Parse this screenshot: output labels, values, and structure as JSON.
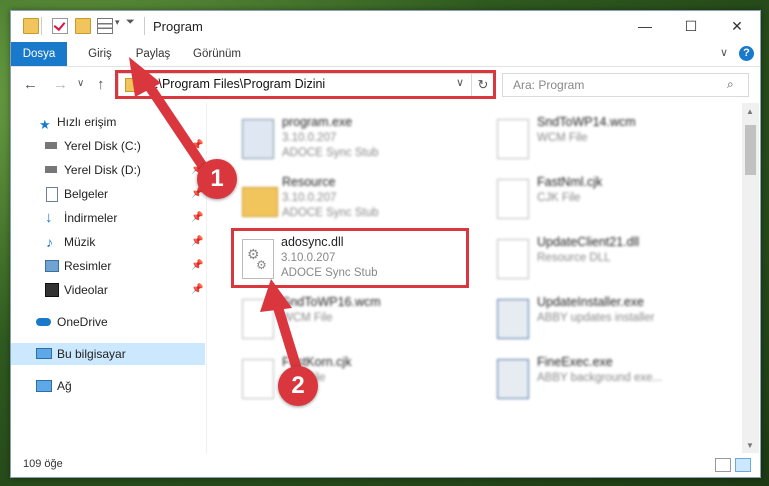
{
  "window": {
    "title": "Program",
    "controls": {
      "minimize": "—",
      "maximize": "☐",
      "close": "✕"
    }
  },
  "ribbon": {
    "tabs": [
      "Dosya",
      "Giriş",
      "Paylaş",
      "Görünüm"
    ],
    "help": "?"
  },
  "nav": {
    "back": "←",
    "forward": "→",
    "recent": "∨",
    "up": "↑",
    "address": "C:\\Program Files\\Program Dizini",
    "refresh": "↻",
    "search_placeholder": "Ara: Program"
  },
  "sidebar": {
    "items": [
      {
        "label": "Hızlı erişim",
        "icon": "star-icon",
        "pinned": false
      },
      {
        "label": "Yerel Disk (C:)",
        "icon": "drive-icon",
        "pinned": true
      },
      {
        "label": "Yerel Disk (D:)",
        "icon": "drive-icon",
        "pinned": true
      },
      {
        "label": "Belgeler",
        "icon": "document-icon",
        "pinned": true
      },
      {
        "label": "İndirmeler",
        "icon": "download-icon",
        "pinned": true
      },
      {
        "label": "Müzik",
        "icon": "music-icon",
        "pinned": true
      },
      {
        "label": "Resimler",
        "icon": "picture-icon",
        "pinned": true
      },
      {
        "label": "Videolar",
        "icon": "video-icon",
        "pinned": true
      },
      {
        "label": "OneDrive",
        "icon": "cloud-icon",
        "pinned": false
      },
      {
        "label": "Bu bilgisayar",
        "icon": "computer-icon",
        "pinned": false,
        "selected": true
      },
      {
        "label": "Ağ",
        "icon": "network-icon",
        "pinned": false
      }
    ]
  },
  "files": [
    {
      "name": "program.exe",
      "version": "3.10.0.207",
      "desc": "ADOCE Sync Stub",
      "type": "exe"
    },
    {
      "name": "SndToWP14.wcm",
      "version": "",
      "desc": "WCM File",
      "type": "doc"
    },
    {
      "name": "Resource",
      "version": "3.10.0.207",
      "desc": "ADOCE Sync Stub",
      "type": "folder"
    },
    {
      "name": "FastNml.cjk",
      "version": "",
      "desc": "CJK File",
      "type": "doc"
    },
    {
      "name": "adosync.dll",
      "version": "3.10.0.207",
      "desc": "ADOCE Sync Stub",
      "type": "dll"
    },
    {
      "name": "UpdateClient21.dll",
      "version": "",
      "desc": "Resource DLL",
      "type": "dll"
    },
    {
      "name": "SndToWP16.wcm",
      "version": "",
      "desc": "WCM File",
      "type": "doc"
    },
    {
      "name": "UpdateInstaller.exe",
      "version": "",
      "desc": "ABBY updates installer",
      "type": "exe2"
    },
    {
      "name": "FastKorn.cjk",
      "version": "",
      "desc": "CJK File",
      "type": "doc"
    },
    {
      "name": "FineExec.exe",
      "version": "",
      "desc": "ABBY background exe...",
      "type": "exe2"
    }
  ],
  "status": {
    "count": "109 öğe"
  },
  "callouts": [
    "1",
    "2"
  ],
  "colors": {
    "accent": "#1979ca",
    "highlight": "#d9363e",
    "selection": "#cce8ff"
  }
}
